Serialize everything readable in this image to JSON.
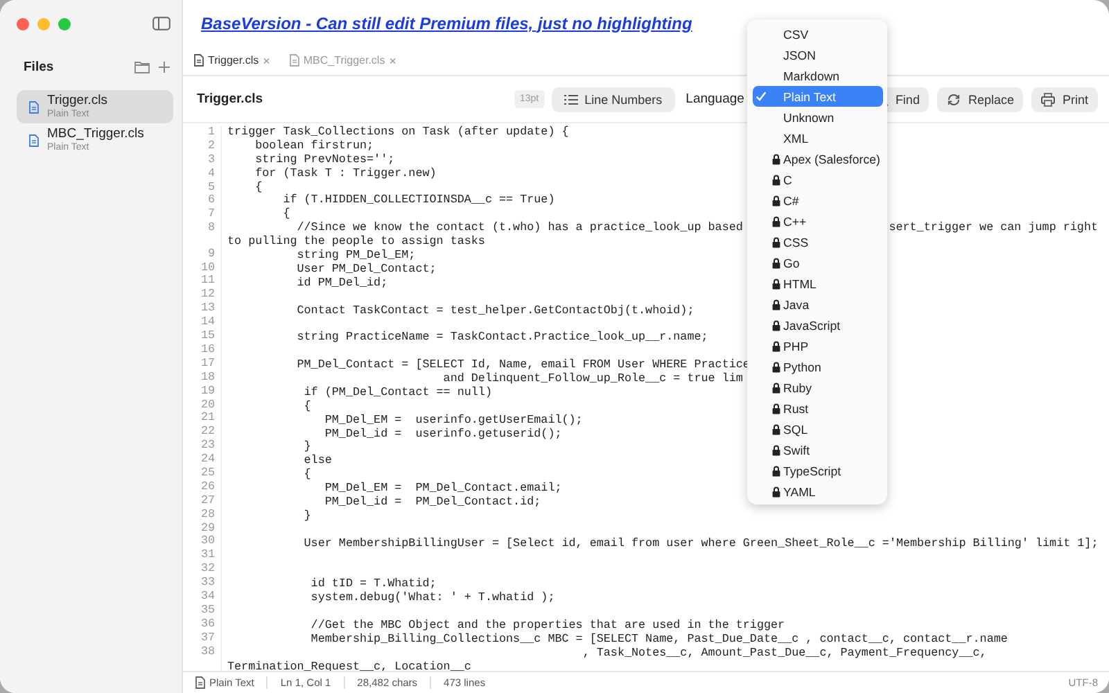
{
  "banner": "BaseVersion - Can still edit Premium files, just no highlighting",
  "sidebar": {
    "title": "Files",
    "items": [
      {
        "name": "Trigger.cls",
        "type": "Plain Text",
        "selected": true
      },
      {
        "name": "MBC_Trigger.cls",
        "type": "Plain Text",
        "selected": false
      }
    ]
  },
  "tabs": [
    {
      "label": "Trigger.cls",
      "selected": true,
      "close": "×"
    },
    {
      "label": "MBC_Trigger.cls",
      "selected": false,
      "close": "×"
    }
  ],
  "header": {
    "file": "Trigger.cls",
    "font_size": "13pt",
    "line_numbers": "Line Numbers",
    "language_label": "Language",
    "buttons": [
      {
        "kind": "find",
        "label": "Find"
      },
      {
        "kind": "replace",
        "label": "Replace"
      },
      {
        "kind": "print",
        "label": "Print"
      }
    ]
  },
  "code": [
    {
      "n": "1",
      "text": "trigger Task_Collections on Task (after update) {"
    },
    {
      "n": "2",
      "text": "    boolean firstrun;"
    },
    {
      "n": "3",
      "text": "    string PrevNotes='';"
    },
    {
      "n": "4",
      "text": "    for (Task T : Trigger.new)"
    },
    {
      "n": "5",
      "text": "    {"
    },
    {
      "n": "6",
      "text": "        if (T.HIDDEN_COLLECTIOINSDA__c == True)"
    },
    {
      "n": "7",
      "text": "        {"
    },
    {
      "n": "8",
      "text": "          //Since we know the contact (t.who) has a practice_look_up based",
      "tail": "sert_trigger we can jump right",
      "wrap": "to pulling the people to assign tasks"
    },
    {
      "n": "9",
      "text": "          string PM_Del_EM;"
    },
    {
      "n": "10",
      "text": "          User PM_Del_Contact;"
    },
    {
      "n": "11",
      "text": "          id PM_Del_id;"
    },
    {
      "n": "12"
    },
    {
      "n": "13",
      "text": "          Contact TaskContact = test_helper.GetContactObj(t.whoid);"
    },
    {
      "n": "14"
    },
    {
      "n": "15",
      "text": "          string PracticeName = TaskContact.Practice_look_up__r.name;"
    },
    {
      "n": "16"
    },
    {
      "n": "17",
      "text": "          PM_Del_Contact = [SELECT Id, Name, email FROM User WHERE Practice"
    },
    {
      "n": "18",
      "text": "                               and Delinquent_Follow_up_Role__c = true lim"
    },
    {
      "n": "19",
      "text": "           if (PM_Del_Contact == null)"
    },
    {
      "n": "20",
      "text": "           {"
    },
    {
      "n": "21",
      "text": "              PM_Del_EM =  userinfo.getUserEmail();"
    },
    {
      "n": "22",
      "text": "              PM_Del_id =  userinfo.getuserid();"
    },
    {
      "n": "23",
      "text": "           }"
    },
    {
      "n": "24",
      "text": "           else"
    },
    {
      "n": "25",
      "text": "           {"
    },
    {
      "n": "26",
      "text": "              PM_Del_EM =  PM_Del_Contact.email;"
    },
    {
      "n": "27",
      "text": "              PM_Del_id =  PM_Del_Contact.id;"
    },
    {
      "n": "28",
      "text": "           }"
    },
    {
      "n": "29"
    },
    {
      "n": "30",
      "text": "           User MembershipBillingUser = [Select id, email from user where Green_Sheet_Role__c ='Membership Billing' limit 1];"
    },
    {
      "n": "31"
    },
    {
      "n": "32"
    },
    {
      "n": "33",
      "text": "            id tID = T.Whatid;"
    },
    {
      "n": "34",
      "text": "            system.debug('What: ' + T.whatid );"
    },
    {
      "n": "35"
    },
    {
      "n": "36",
      "text": "            //Get the MBC Object and the properties that are used in the trigger"
    },
    {
      "n": "37",
      "text": "            Membership_Billing_Collections__c MBC = [SELECT Name, Past_Due_Date__c , contact__c, contact__r.name"
    },
    {
      "n": "38",
      "text": "                                                   , Task_Notes__c, Amount_Past_Due__c, Payment_Frequency__c,",
      "wrap": "Termination_Request__c, Location__c"
    }
  ],
  "status_bar": {
    "language": "Plain Text",
    "position": "Ln 1, Col 1",
    "chars": "28,482 chars",
    "lines": "473 lines",
    "encoding": "UTF-8"
  },
  "language_menu": [
    {
      "label": "CSV",
      "selected": false,
      "locked": false
    },
    {
      "label": "JSON",
      "selected": false,
      "locked": false
    },
    {
      "label": "Markdown",
      "selected": false,
      "locked": false
    },
    {
      "label": "Plain Text",
      "selected": true,
      "locked": false
    },
    {
      "label": "Unknown",
      "selected": false,
      "locked": false
    },
    {
      "label": "XML",
      "selected": false,
      "locked": false
    },
    {
      "label": "Apex (Salesforce)",
      "selected": false,
      "locked": true
    },
    {
      "label": "C",
      "selected": false,
      "locked": true
    },
    {
      "label": "C#",
      "selected": false,
      "locked": true
    },
    {
      "label": "C++",
      "selected": false,
      "locked": true
    },
    {
      "label": "CSS",
      "selected": false,
      "locked": true
    },
    {
      "label": "Go",
      "selected": false,
      "locked": true
    },
    {
      "label": "HTML",
      "selected": false,
      "locked": true
    },
    {
      "label": "Java",
      "selected": false,
      "locked": true
    },
    {
      "label": "JavaScript",
      "selected": false,
      "locked": true
    },
    {
      "label": "PHP",
      "selected": false,
      "locked": true
    },
    {
      "label": "Python",
      "selected": false,
      "locked": true
    },
    {
      "label": "Ruby",
      "selected": false,
      "locked": true
    },
    {
      "label": "Rust",
      "selected": false,
      "locked": true
    },
    {
      "label": "SQL",
      "selected": false,
      "locked": true
    },
    {
      "label": "Swift",
      "selected": false,
      "locked": true
    },
    {
      "label": "TypeScript",
      "selected": false,
      "locked": true
    },
    {
      "label": "YAML",
      "selected": false,
      "locked": true
    }
  ]
}
